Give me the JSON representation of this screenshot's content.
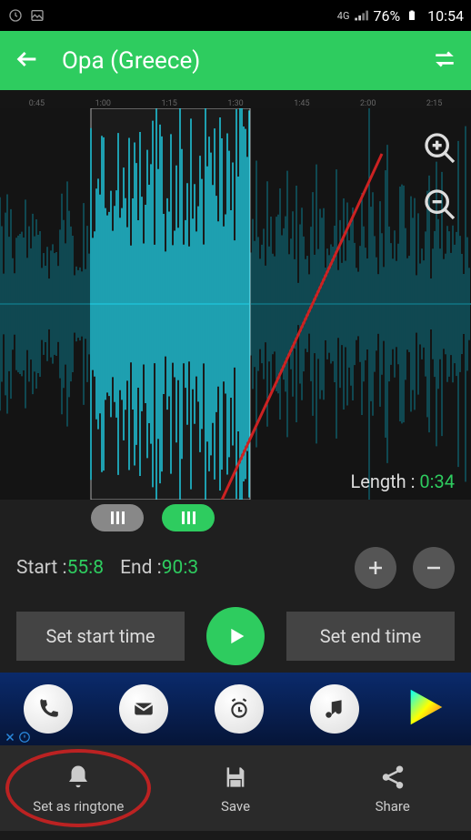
{
  "status": {
    "network": "4G",
    "battery": "76%",
    "time": "10:54"
  },
  "header": {
    "title": "Opa (Greece)"
  },
  "timeline": {
    "ticks": [
      "0:45",
      "1:00",
      "1:15",
      "1:30",
      "1:45",
      "2:00",
      "2:15"
    ]
  },
  "length": {
    "label": "Length : ",
    "value": "0:34"
  },
  "times": {
    "start_label": "Start : ",
    "start_value": "55:8",
    "end_label": "End : ",
    "end_value": "90:3"
  },
  "buttons": {
    "set_start": "Set start time",
    "set_end": "Set end time"
  },
  "nav": {
    "ringtone": "Set as ringtone",
    "save": "Save",
    "share": "Share"
  }
}
